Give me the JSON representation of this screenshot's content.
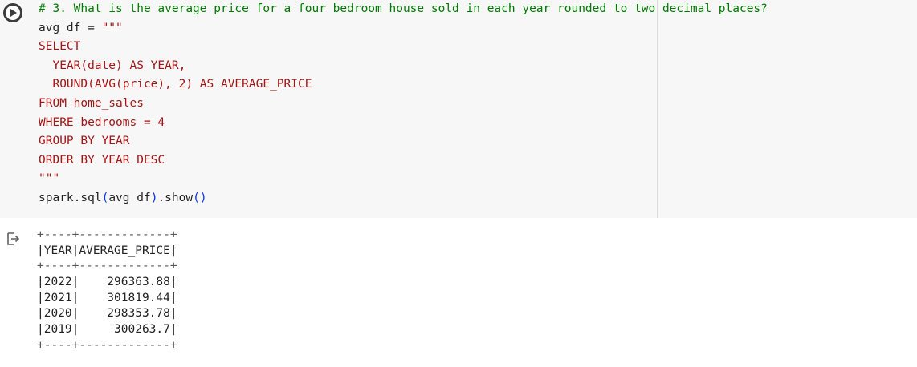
{
  "code_cell": {
    "lines": [
      {
        "parts": [
          {
            "cls": "c-comment",
            "text": "# 3. What is the average price for a four bedroom house sold in each year rounded to two decimal places?"
          }
        ]
      },
      {
        "parts": [
          {
            "cls": "c-plain",
            "text": "avg_df = "
          },
          {
            "cls": "c-str",
            "text": "\"\"\""
          }
        ]
      },
      {
        "parts": [
          {
            "cls": "c-str",
            "text": "SELECT"
          }
        ]
      },
      {
        "parts": [
          {
            "cls": "c-str",
            "text": "  YEAR(date) AS YEAR,"
          }
        ]
      },
      {
        "parts": [
          {
            "cls": "c-str",
            "text": "  ROUND(AVG(price), 2) AS AVERAGE_PRICE"
          }
        ]
      },
      {
        "parts": [
          {
            "cls": "c-str",
            "text": "FROM home_sales"
          }
        ]
      },
      {
        "parts": [
          {
            "cls": "c-str",
            "text": "WHERE bedrooms = 4"
          }
        ]
      },
      {
        "parts": [
          {
            "cls": "c-str",
            "text": "GROUP BY YEAR"
          }
        ]
      },
      {
        "parts": [
          {
            "cls": "c-str",
            "text": "ORDER BY YEAR DESC"
          }
        ]
      },
      {
        "parts": [
          {
            "cls": "c-str",
            "text": "\"\"\""
          }
        ]
      },
      {
        "parts": [
          {
            "cls": "c-plain",
            "text": "spark.sql"
          },
          {
            "cls": "c-punc",
            "text": "("
          },
          {
            "cls": "c-plain",
            "text": "avg_df"
          },
          {
            "cls": "c-punc",
            "text": ")"
          },
          {
            "cls": "c-plain",
            "text": ".show"
          },
          {
            "cls": "c-punc",
            "text": "()"
          }
        ]
      }
    ]
  },
  "output": {
    "border_top": "+----+-------------+",
    "header": "|YEAR|AVERAGE_PRICE|",
    "border_mid": "+----+-------------+",
    "rows": [
      "|2022|    296363.88|",
      "|2021|    301819.44|",
      "|2020|    298353.78|",
      "|2019|     300263.7|"
    ],
    "border_bottom": "+----+-------------+"
  },
  "icons": {
    "run": "play-icon",
    "output": "output-arrow-icon"
  }
}
